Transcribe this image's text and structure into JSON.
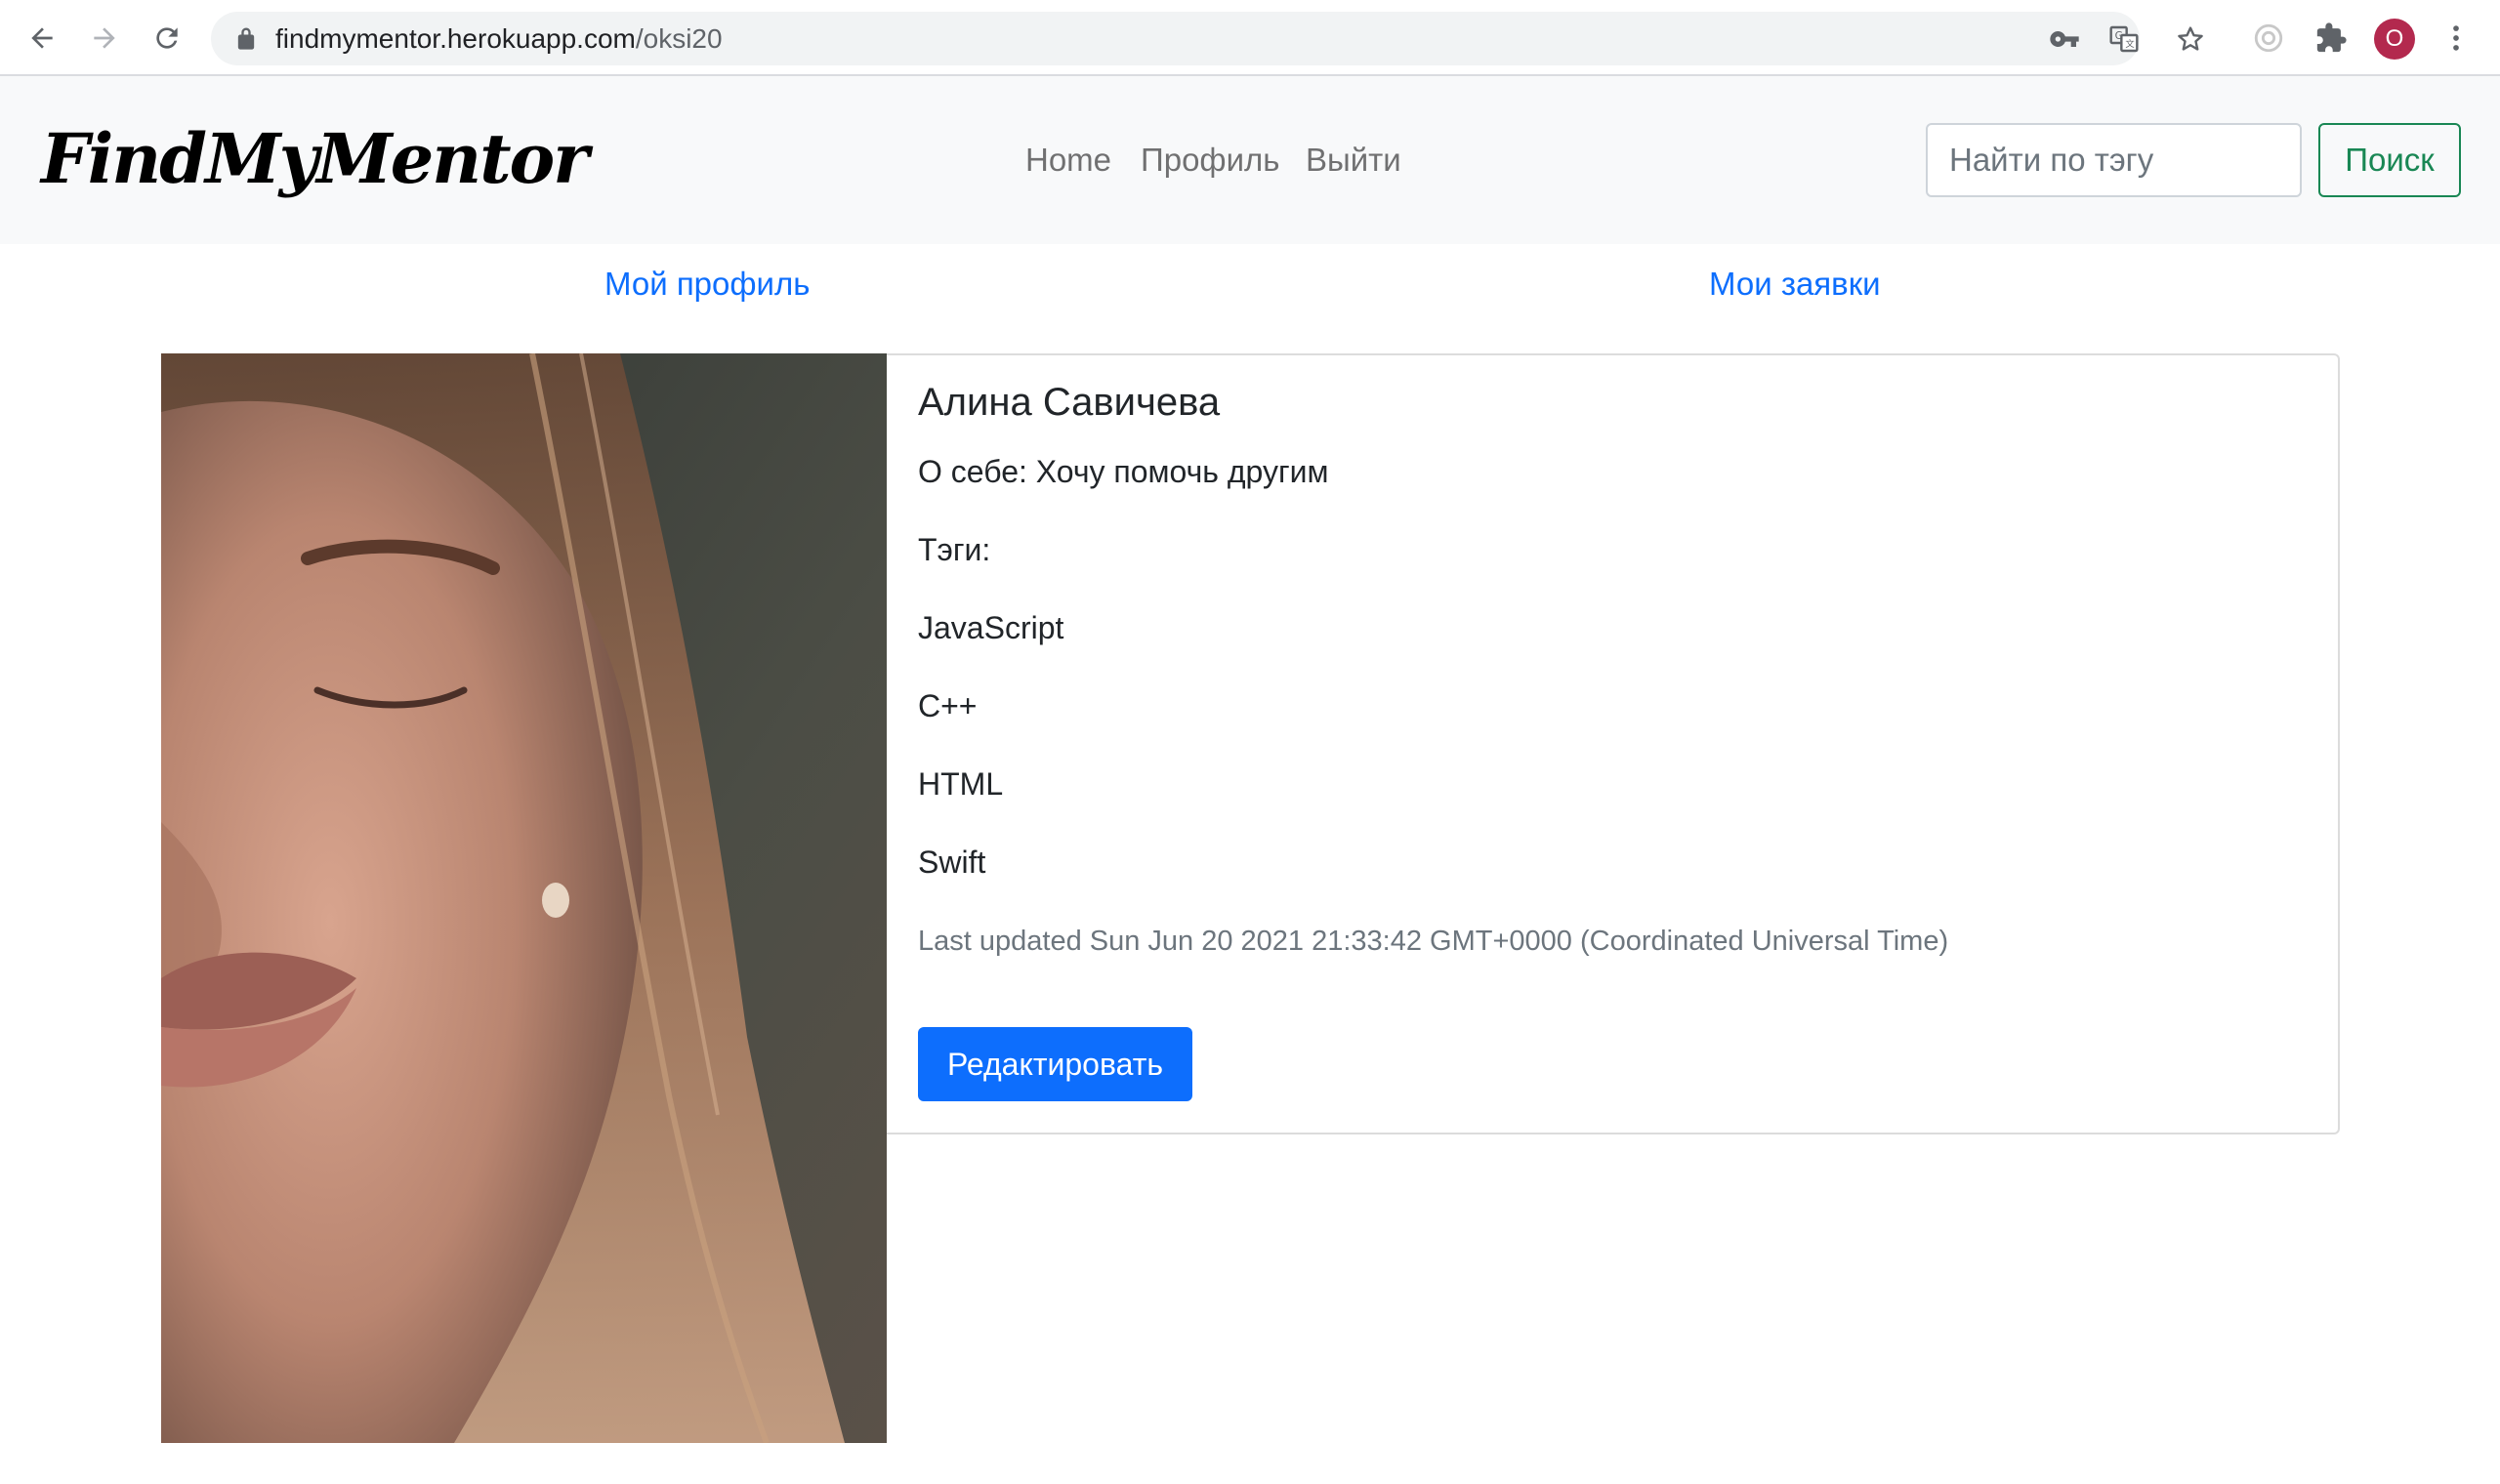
{
  "browser": {
    "url_host": "findmymentor.herokuapp.com",
    "url_path": "/oksi20",
    "profile_initial": "O",
    "icons": [
      "back-icon",
      "forward-icon",
      "reload-icon",
      "lock-icon",
      "key-icon",
      "translate-icon",
      "star-icon",
      "extension-icon",
      "puzzle-icon",
      "menu-dots-icon"
    ]
  },
  "navbar": {
    "brand": "FindMyMentor",
    "links": [
      "Home",
      "Профиль",
      "Выйти"
    ],
    "search_placeholder": "Найти по тэгу",
    "search_button": "Поиск"
  },
  "tabs": {
    "my_profile": "Мой профиль",
    "my_requests": "Мои заявки"
  },
  "profile": {
    "name": "Алина Савичева",
    "about": "О себе: Хочу помочь другим",
    "tags_label": "Тэги:",
    "tags": [
      "JavaScript",
      "C++",
      "HTML",
      "Swift"
    ],
    "last_updated": "Last updated Sun Jun 20 2021 21:33:42 GMT+0000 (Coordinated Universal Time)",
    "edit_button": "Редактировать"
  },
  "colors": {
    "link": "#0d6efd",
    "primary_button": "#0d6efd",
    "success_outline": "#198754",
    "navbar_bg": "#f8f9fa",
    "avatar_bg": "#b3294e"
  }
}
